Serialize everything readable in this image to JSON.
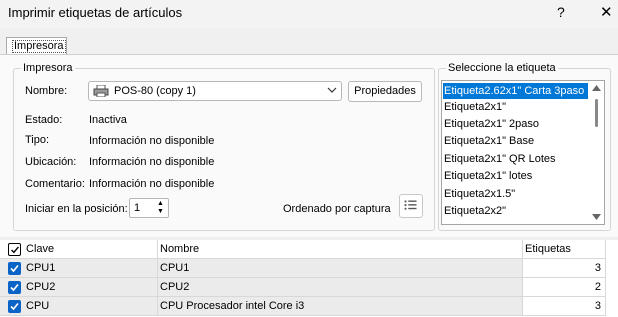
{
  "window": {
    "title": "Imprimir etiquetas de artículos",
    "help_glyph": "?",
    "close_glyph": "✕"
  },
  "tabs": [
    {
      "label": "Impresora",
      "active": true
    }
  ],
  "printer_group": {
    "legend": "Impresora",
    "nombre_label": "Nombre:",
    "nombre_value": "POS-80 (copy 1)",
    "propiedades_label": "Propiedades",
    "estado_label": "Estado:",
    "estado_value": "Inactiva",
    "tipo_label": "Tipo:",
    "tipo_value": "Información no disponible",
    "ubicacion_label": "Ubicación:",
    "ubicacion_value": "Información no disponible",
    "comentario_label": "Comentario:",
    "comentario_value": "Información no disponible",
    "iniciar_label": "Iniciar en la posición:",
    "iniciar_value": "1",
    "ordenado_label": "Ordenado por captura"
  },
  "label_group": {
    "legend": "Seleccione la etiqueta",
    "items": [
      {
        "label": "Etiqueta2.62x1\" Carta 3paso",
        "selected": true
      },
      {
        "label": "Etiqueta2x1\"",
        "selected": false
      },
      {
        "label": "Etiqueta2x1\" 2paso",
        "selected": false
      },
      {
        "label": "Etiqueta2x1\" Base",
        "selected": false
      },
      {
        "label": "Etiqueta2x1\" QR Lotes",
        "selected": false
      },
      {
        "label": "Etiqueta2x1\" lotes",
        "selected": false
      },
      {
        "label": "Etiqueta2x1.5\"",
        "selected": false
      },
      {
        "label": "Etiqueta2x2\"",
        "selected": false
      }
    ]
  },
  "table": {
    "headers": {
      "clave": "Clave",
      "nombre": "Nombre",
      "etiquetas": "Etiquetas"
    },
    "rows": [
      {
        "checked": true,
        "clave": "CPU1",
        "nombre": "CPU1",
        "etiquetas": "3"
      },
      {
        "checked": true,
        "clave": "CPU2",
        "nombre": "CPU2",
        "etiquetas": "2"
      },
      {
        "checked": true,
        "clave": "CPU",
        "nombre": "CPU Procesador intel Core i3",
        "etiquetas": "3"
      }
    ]
  },
  "colors": {
    "selection": "#0078d7",
    "checkbox": "#0a64c8"
  }
}
